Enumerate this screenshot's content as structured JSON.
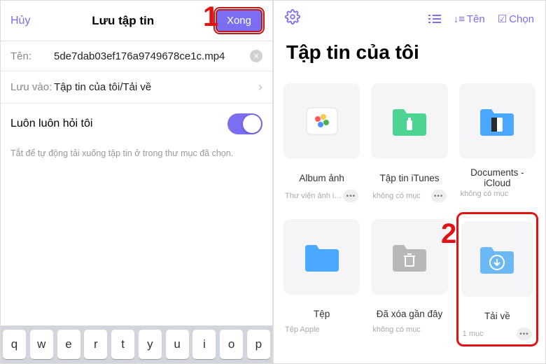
{
  "left": {
    "cancel": "Hủy",
    "title": "Lưu tập tin",
    "done": "Xong",
    "name_label": "Tên:",
    "name_value": "5de7dab03ef176a9749678ce1c.mp4",
    "saveTo_label": "Lưu vào:",
    "saveTo_value": "Tập tin của tôi/Tải về",
    "ask_label": "Luôn luôn hỏi tôi",
    "hint": "Tắt để tự động tải xuống tập tin ở trong thư mục đã chọn.",
    "keys": [
      "q",
      "w",
      "e",
      "r",
      "t",
      "y",
      "u",
      "i",
      "o",
      "p"
    ]
  },
  "right": {
    "sort_label": "Tên",
    "select_label": "Chọn",
    "page_title": "Tập tin của tôi",
    "tiles": [
      {
        "name": "Album ảnh",
        "sub": "Thư viện ảnh i…",
        "more": true,
        "icon": "photos"
      },
      {
        "name": "Tập tin iTunes",
        "sub": "không có mục",
        "more": true,
        "icon": "green-folder"
      },
      {
        "name": "Documents - iCloud",
        "sub": "không có mục",
        "more": false,
        "icon": "blue-doc"
      },
      {
        "name": "Tệp",
        "sub": "Tệp Apple",
        "more": false,
        "icon": "blue-folder"
      },
      {
        "name": "Đã xóa gần đây",
        "sub": "không có mục",
        "more": false,
        "icon": "trash-folder"
      },
      {
        "name": "Tải về",
        "sub": "1 mục",
        "more": true,
        "icon": "download-folder",
        "highlight": true
      }
    ]
  },
  "callouts": {
    "one": "1",
    "two": "2"
  }
}
